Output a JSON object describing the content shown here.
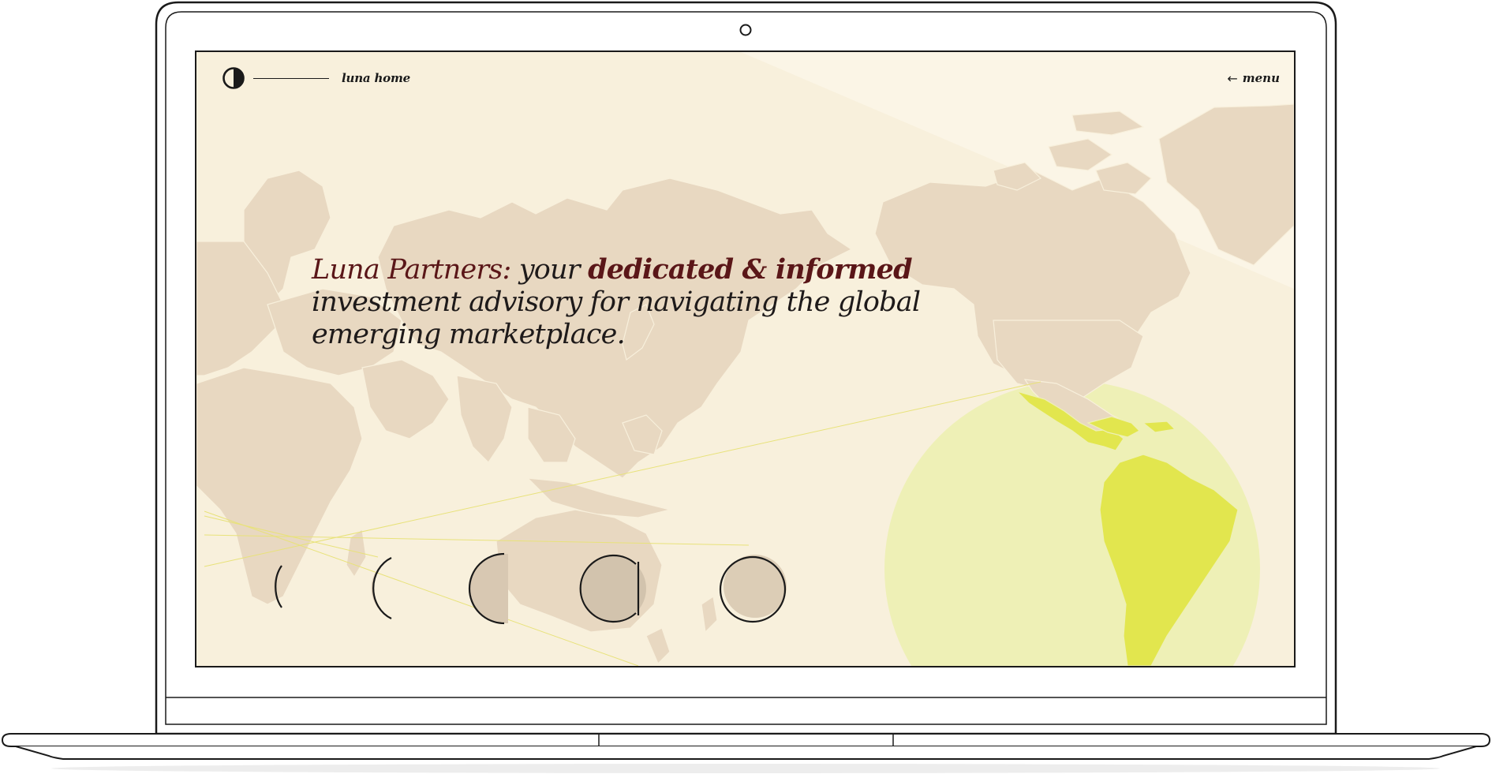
{
  "nav": {
    "home_label": "luna home",
    "menu_arrow": "←",
    "menu_label": "menu",
    "logo_icon": "half-moon-icon"
  },
  "hero": {
    "headline_brand": "Luna Partners:",
    "headline_pre": " your ",
    "headline_emphasis": "dedicated & informed",
    "headline_rest": "investment advisory for navigating the global emerging marketplace."
  },
  "moon_phases": {
    "count": 5,
    "icon": "moon-phase-icon"
  },
  "colors": {
    "background": "#f8f0dc",
    "land": "#e8d8c0",
    "highlight_circle": "#eef0a8",
    "highlight_land": "#e2e64e",
    "headline_accent": "#5a1618",
    "ink": "#1a1a1a"
  }
}
